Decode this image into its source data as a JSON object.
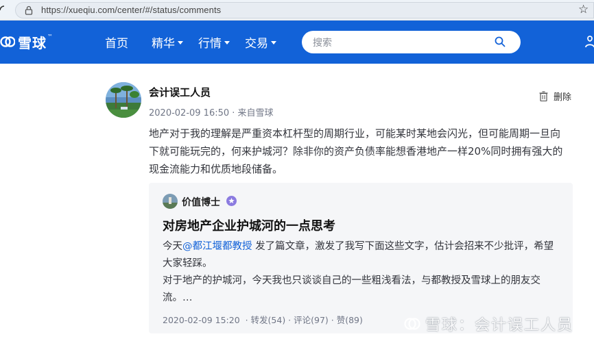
{
  "browser": {
    "url": "https://xueqiu.com/center/#/status/comments"
  },
  "header": {
    "logo_text": "雪球",
    "logo_tm": "™",
    "nav": [
      "首页",
      "精华",
      "行情",
      "交易"
    ],
    "search_placeholder": "搜索"
  },
  "post": {
    "author": "会计误工人员",
    "time": "2020-02-09 16:50",
    "source": "· 来自雪球",
    "delete_label": "删除",
    "body": "地产对于我的理解是严重资本杠杆型的周期行业，可能某时某地会闪光，但可能周期一旦向下就可能玩完的，何来护城河？除非你的资产负债率能想香港地产一样20%同时拥有强大的现金流能力和优质地段储备。"
  },
  "quoted": {
    "author": "价值博士",
    "title": "对房地产企业护城河的一点思考",
    "excerpt_prefix": "今天",
    "mention": "@都江堰都教授",
    "excerpt_rest": " 发了篇文章，激发了我写下面这些文字，估计会招来不少批评，希望大家轻踩。",
    "excerpt_line2": "对于地产的护城河，今天我也只谈谈自己的一些粗浅看法，与都教授及雪球上的朋友交流。…",
    "time": "2020-02-09 15:20",
    "stats": "· 转发(54) · 评论(97) · 赞(89)"
  },
  "watermark": "雪球：会计误工人员",
  "colors": {
    "brand_blue": "#1262d8",
    "card_bg": "#f5f6f8",
    "meta_gray": "#707686"
  }
}
